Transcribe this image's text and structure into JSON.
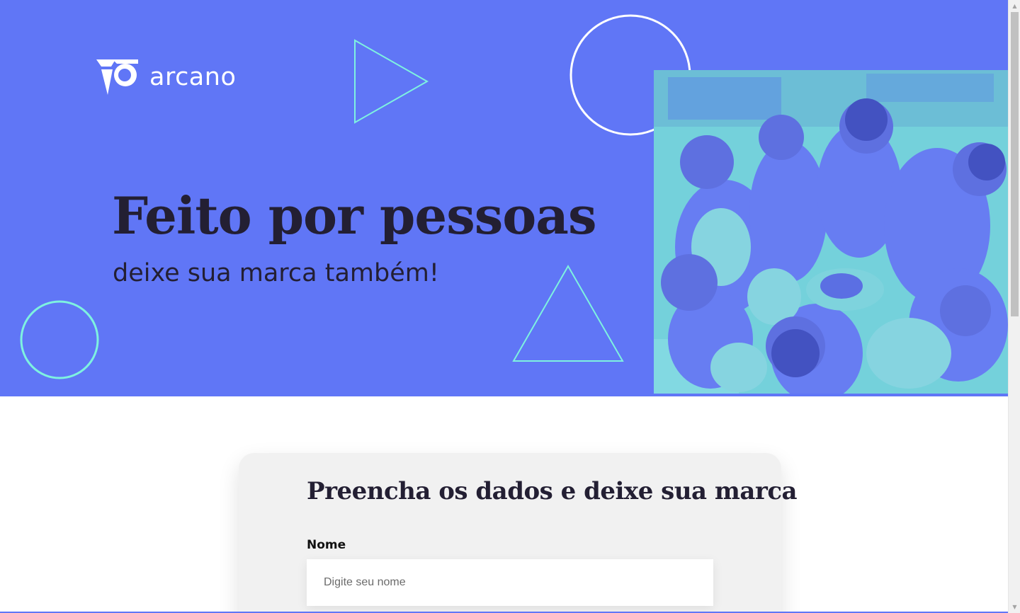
{
  "brand": {
    "name": "arcano",
    "logo_icon": "arcano-logo-icon"
  },
  "hero": {
    "title": "Feito por pessoas",
    "subtitle": "deixe sua marca também!",
    "photo_icon": "team-hands-photo"
  },
  "form": {
    "title": "Preencha os dados e deixe sua marca",
    "fields": [
      {
        "label": "Nome",
        "placeholder": "Digite seu nome",
        "value": ""
      }
    ]
  },
  "colors": {
    "hero_bg": "#6076f6",
    "accent_outline": "#7ef2e0",
    "text_dark": "#231f33",
    "card_bg": "#f1f1f1",
    "photo_tint": "#7be8d8"
  }
}
